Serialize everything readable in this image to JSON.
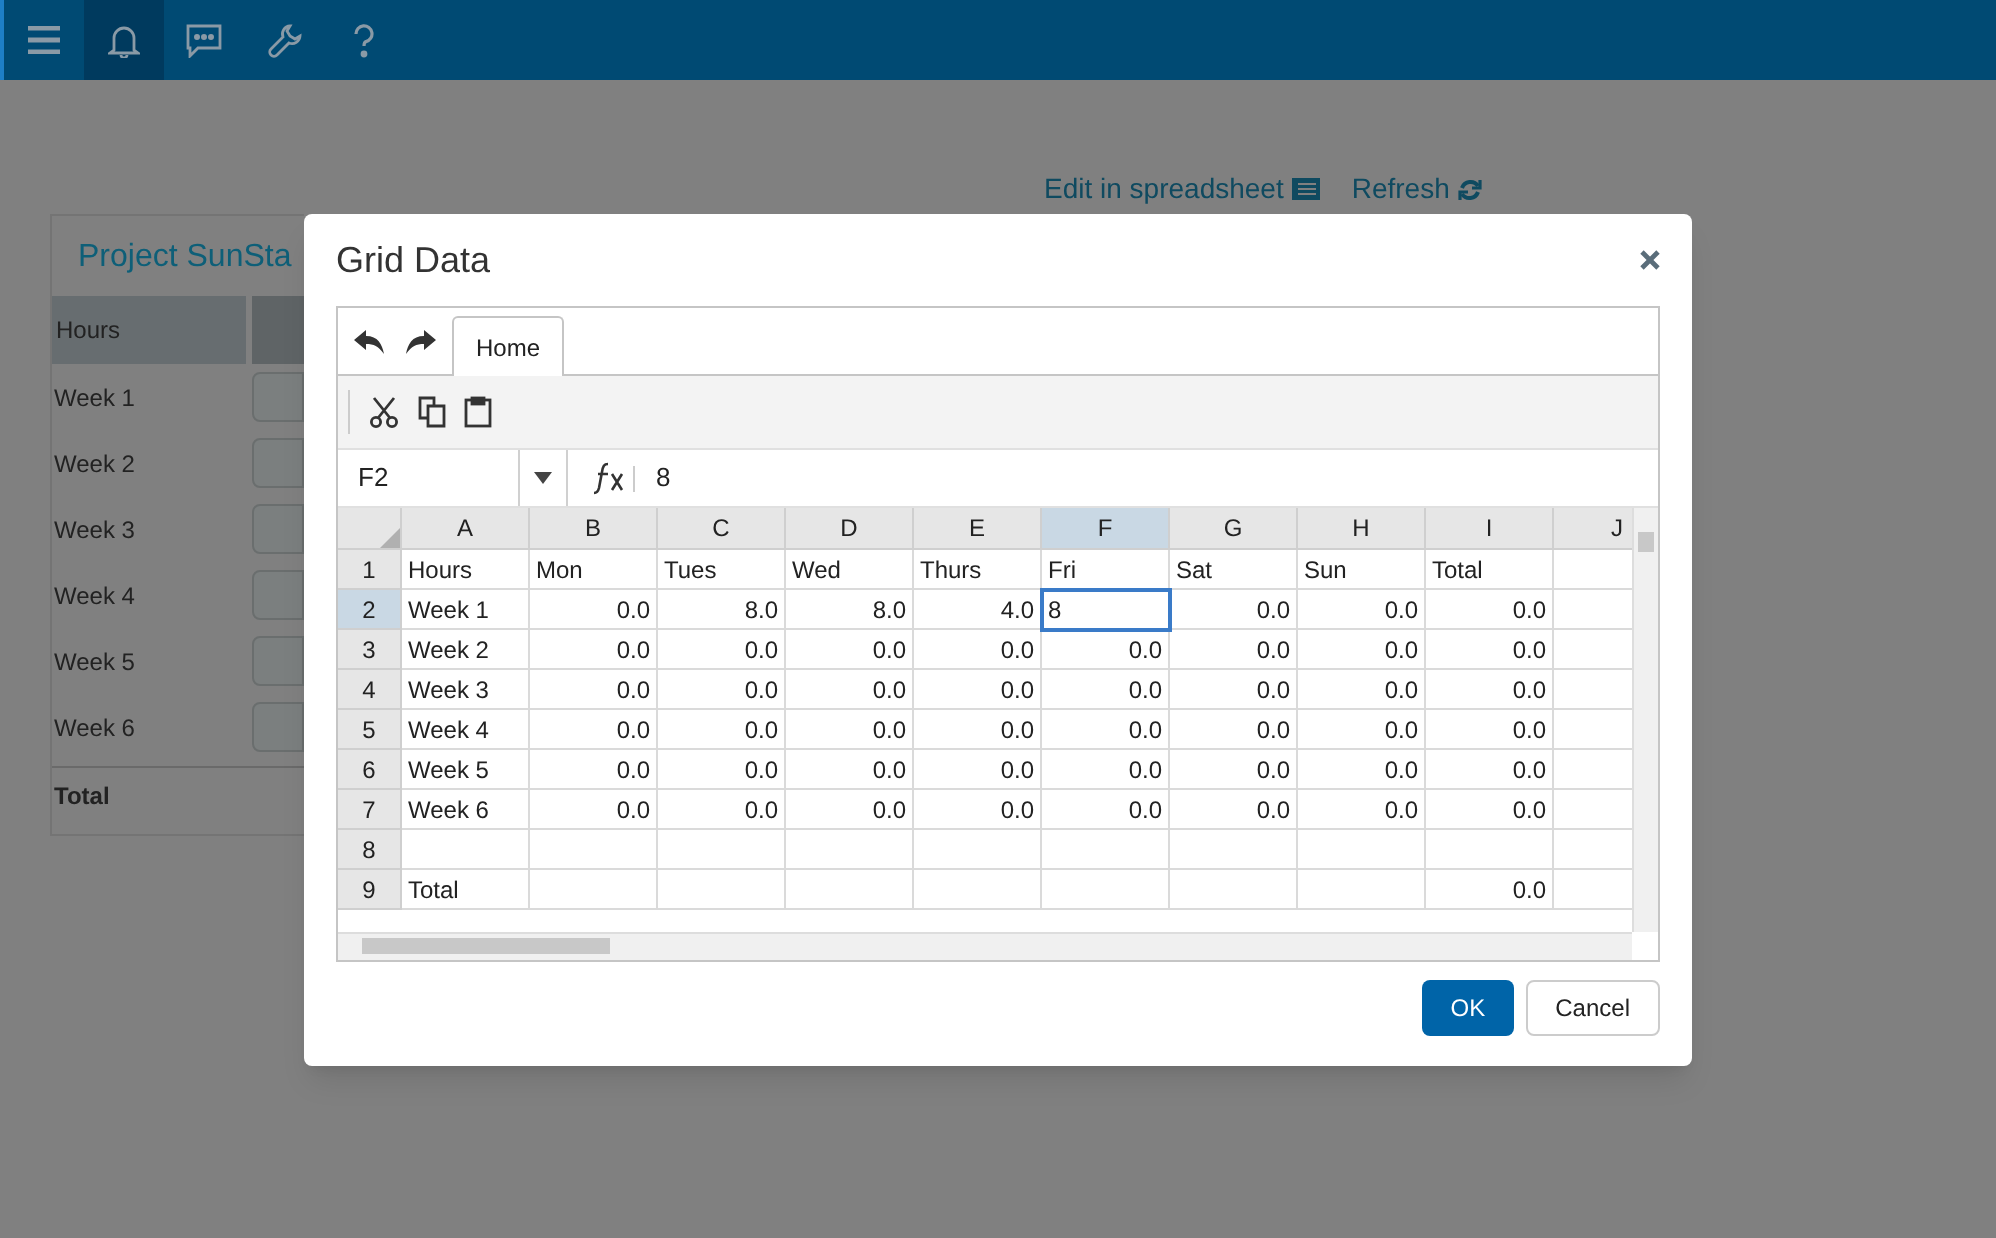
{
  "nav": {
    "items": [
      {
        "kind": "menu",
        "selected": false
      },
      {
        "kind": "bell",
        "selected": true
      },
      {
        "kind": "chat",
        "selected": false
      },
      {
        "kind": "wrench",
        "selected": false
      },
      {
        "kind": "help",
        "selected": false
      }
    ]
  },
  "links": [
    {
      "label": "Edit in spreadsheet",
      "kind": "sheet"
    },
    {
      "label": "Refresh",
      "kind": "refresh"
    }
  ],
  "card": {
    "title": "Project SunSta",
    "header": "Hours",
    "rows": [
      "Week 1",
      "Week 2",
      "Week 3",
      "Week 4",
      "Week 5",
      "Week 6"
    ],
    "total": "Total"
  },
  "dialog": {
    "title": "Grid Data",
    "tabs": [
      {
        "label": "Home",
        "selected": true
      }
    ],
    "name_box": "F2",
    "formula": "8",
    "columns": [
      {
        "label": "A",
        "selected": false
      },
      {
        "label": "B",
        "selected": false
      },
      {
        "label": "C",
        "selected": false
      },
      {
        "label": "D",
        "selected": false
      },
      {
        "label": "E",
        "selected": false
      },
      {
        "label": "F",
        "selected": true
      },
      {
        "label": "G",
        "selected": false
      },
      {
        "label": "H",
        "selected": false
      },
      {
        "label": "I",
        "selected": false
      },
      {
        "label": "J",
        "selected": false
      }
    ],
    "rows": [
      {
        "number": "1",
        "selected": false,
        "cells": [
          {
            "text": "Hours",
            "kind": "text"
          },
          {
            "text": "Mon",
            "kind": "text"
          },
          {
            "text": "Tues",
            "kind": "text"
          },
          {
            "text": "Wed",
            "kind": "text"
          },
          {
            "text": "Thurs",
            "kind": "text"
          },
          {
            "text": "Fri",
            "kind": "text"
          },
          {
            "text": "Sat",
            "kind": "text"
          },
          {
            "text": "Sun",
            "kind": "text"
          },
          {
            "text": "Total",
            "kind": "text"
          },
          null
        ]
      },
      {
        "number": "2",
        "selected": true,
        "cells": [
          {
            "text": "Week 1",
            "kind": "text"
          },
          {
            "text": "0.0",
            "kind": "number"
          },
          {
            "text": "8.0",
            "kind": "number"
          },
          {
            "text": "8.0",
            "kind": "number"
          },
          {
            "text": "4.0",
            "kind": "number"
          },
          {
            "text": "8",
            "kind": "text",
            "editing": true
          },
          {
            "text": "0.0",
            "kind": "number"
          },
          {
            "text": "0.0",
            "kind": "number"
          },
          {
            "text": "0.0",
            "kind": "number"
          },
          null
        ]
      },
      {
        "number": "3",
        "selected": false,
        "cells": [
          {
            "text": "Week 2",
            "kind": "text"
          },
          {
            "text": "0.0",
            "kind": "number"
          },
          {
            "text": "0.0",
            "kind": "number"
          },
          {
            "text": "0.0",
            "kind": "number"
          },
          {
            "text": "0.0",
            "kind": "number"
          },
          {
            "text": "0.0",
            "kind": "number"
          },
          {
            "text": "0.0",
            "kind": "number"
          },
          {
            "text": "0.0",
            "kind": "number"
          },
          {
            "text": "0.0",
            "kind": "number"
          },
          null
        ]
      },
      {
        "number": "4",
        "selected": false,
        "cells": [
          {
            "text": "Week 3",
            "kind": "text"
          },
          {
            "text": "0.0",
            "kind": "number"
          },
          {
            "text": "0.0",
            "kind": "number"
          },
          {
            "text": "0.0",
            "kind": "number"
          },
          {
            "text": "0.0",
            "kind": "number"
          },
          {
            "text": "0.0",
            "kind": "number"
          },
          {
            "text": "0.0",
            "kind": "number"
          },
          {
            "text": "0.0",
            "kind": "number"
          },
          {
            "text": "0.0",
            "kind": "number"
          },
          null
        ]
      },
      {
        "number": "5",
        "selected": false,
        "cells": [
          {
            "text": "Week 4",
            "kind": "text"
          },
          {
            "text": "0.0",
            "kind": "number"
          },
          {
            "text": "0.0",
            "kind": "number"
          },
          {
            "text": "0.0",
            "kind": "number"
          },
          {
            "text": "0.0",
            "kind": "number"
          },
          {
            "text": "0.0",
            "kind": "number"
          },
          {
            "text": "0.0",
            "kind": "number"
          },
          {
            "text": "0.0",
            "kind": "number"
          },
          {
            "text": "0.0",
            "kind": "number"
          },
          null
        ]
      },
      {
        "number": "6",
        "selected": false,
        "cells": [
          {
            "text": "Week 5",
            "kind": "text"
          },
          {
            "text": "0.0",
            "kind": "number"
          },
          {
            "text": "0.0",
            "kind": "number"
          },
          {
            "text": "0.0",
            "kind": "number"
          },
          {
            "text": "0.0",
            "kind": "number"
          },
          {
            "text": "0.0",
            "kind": "number"
          },
          {
            "text": "0.0",
            "kind": "number"
          },
          {
            "text": "0.0",
            "kind": "number"
          },
          {
            "text": "0.0",
            "kind": "number"
          },
          null
        ]
      },
      {
        "number": "7",
        "selected": false,
        "cells": [
          {
            "text": "Week 6",
            "kind": "text"
          },
          {
            "text": "0.0",
            "kind": "number"
          },
          {
            "text": "0.0",
            "kind": "number"
          },
          {
            "text": "0.0",
            "kind": "number"
          },
          {
            "text": "0.0",
            "kind": "number"
          },
          {
            "text": "0.0",
            "kind": "number"
          },
          {
            "text": "0.0",
            "kind": "number"
          },
          {
            "text": "0.0",
            "kind": "number"
          },
          {
            "text": "0.0",
            "kind": "number"
          },
          null
        ]
      },
      {
        "number": "8",
        "selected": false,
        "cells": [
          null,
          null,
          null,
          null,
          null,
          null,
          null,
          null,
          null,
          null
        ]
      },
      {
        "number": "9",
        "selected": false,
        "cells": [
          {
            "text": "Total",
            "kind": "text"
          },
          null,
          null,
          null,
          null,
          null,
          null,
          null,
          {
            "text": "0.0",
            "kind": "number"
          },
          null
        ]
      }
    ],
    "buttons": [
      {
        "label": "OK",
        "kind": "primary"
      },
      {
        "label": "Cancel",
        "kind": "secondary"
      }
    ]
  }
}
